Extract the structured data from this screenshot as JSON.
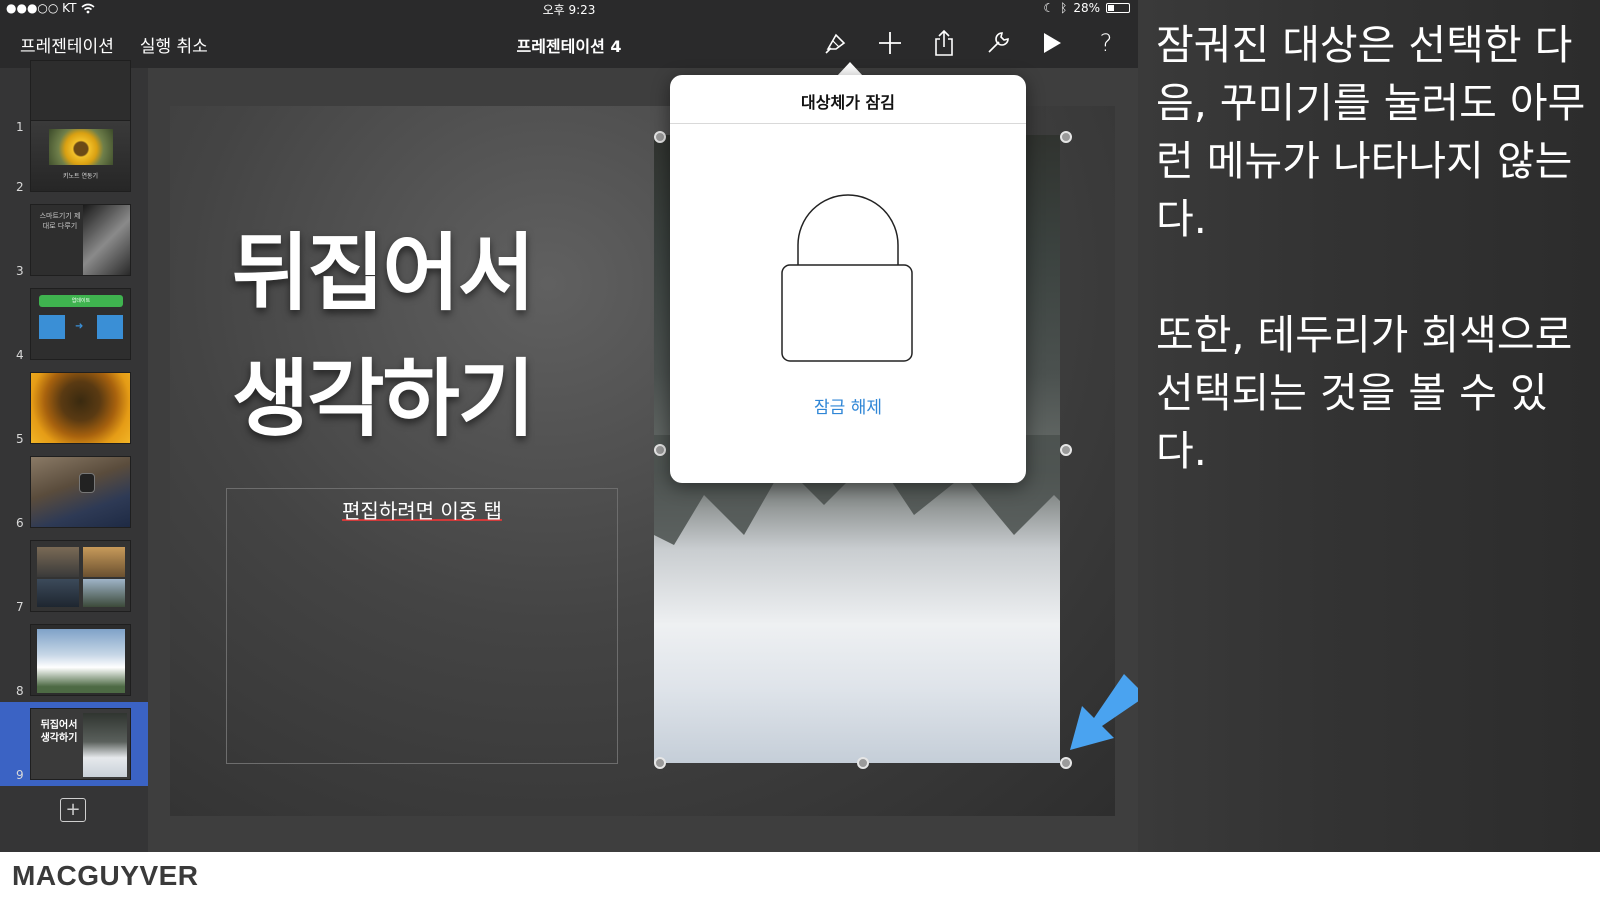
{
  "status_bar": {
    "carrier": "●●●○○ KT",
    "time": "오후 9:23",
    "battery_percent": "28%",
    "battery_level": 0.28
  },
  "toolbar": {
    "presentations_label": "프레젠테이션",
    "undo_label": "실행 취소",
    "document_title": "프레젠테이션 4",
    "icons": [
      "format-brush-icon",
      "plus-icon",
      "share-icon",
      "wrench-icon",
      "play-icon",
      "help-icon"
    ],
    "help_glyph": "?"
  },
  "navigator": {
    "slides": [
      {
        "number": "1"
      },
      {
        "number": "2",
        "caption": "키노트 연동기"
      },
      {
        "number": "3",
        "caption": "스마트기기 제대로 다루기"
      },
      {
        "number": "4",
        "caption": "업데이트"
      },
      {
        "number": "5"
      },
      {
        "number": "6"
      },
      {
        "number": "7"
      },
      {
        "number": "8"
      },
      {
        "number": "9",
        "caption": "뒤집어서 생각하기",
        "selected": true
      }
    ],
    "add_glyph": "+"
  },
  "slide": {
    "title_line1": "뒤집어서",
    "title_line2": "생각하기",
    "body_placeholder": "편집하려면 이중 탭"
  },
  "popover": {
    "title": "대상체가 잠김",
    "unlock_label": "잠금 해제",
    "icon": "lock-icon"
  },
  "explanation": {
    "paragraph1": "잠궈진 대상은 선택한 다음, 꾸미기를 눌러도 아무런 메뉴가 나타나지 않는다.",
    "paragraph2": "또한, 테두리가 회색으로 선택되는 것을 볼 수 있다."
  },
  "footer": {
    "brand": "MACGUYVER"
  },
  "colors": {
    "accent_blue": "#2f86d6",
    "selected_thumb": "#3b63c4",
    "annotation_arrow": "#4aa3f0"
  }
}
